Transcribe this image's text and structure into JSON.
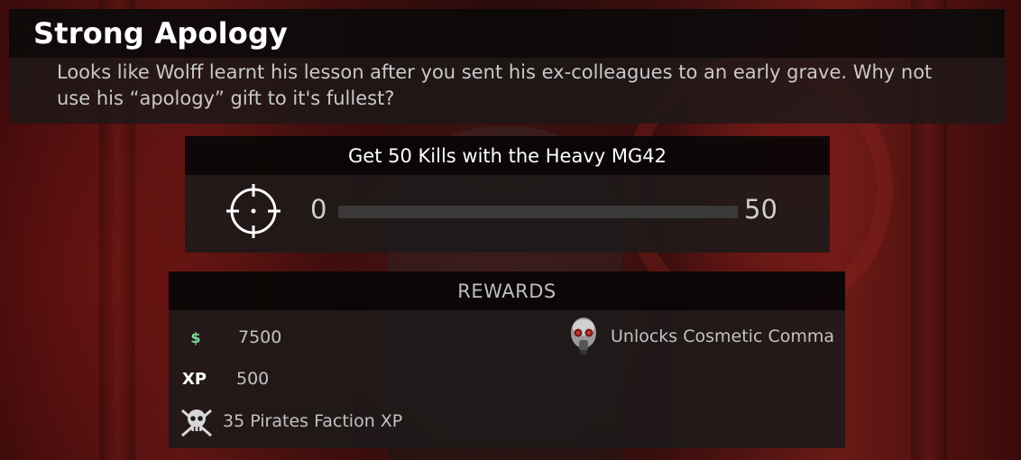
{
  "challenge": {
    "title": "Strong Apology",
    "description": "Looks like Wolff learnt his lesson after you sent his ex-colleagues to an early grave. Why not use his “apology” gift to it's fullest?"
  },
  "objective": {
    "label": "Get 50 Kills with the Heavy MG42",
    "icon": "crosshair-icon",
    "progress_current": "0",
    "progress_target": "50",
    "progress_fraction": 0
  },
  "rewards": {
    "header": "REWARDS",
    "money": {
      "icon": "dollar-icon",
      "value": "7500",
      "color": "#7ed79a"
    },
    "xp": {
      "icon_label": "XP",
      "value": "500"
    },
    "faction": {
      "icon": "pirate-skull-icon",
      "value": "35 Pirates Faction XP"
    },
    "cosmetic": {
      "icon": "gas-mask-icon",
      "value": "Unlocks Cosmetic Comma"
    }
  }
}
